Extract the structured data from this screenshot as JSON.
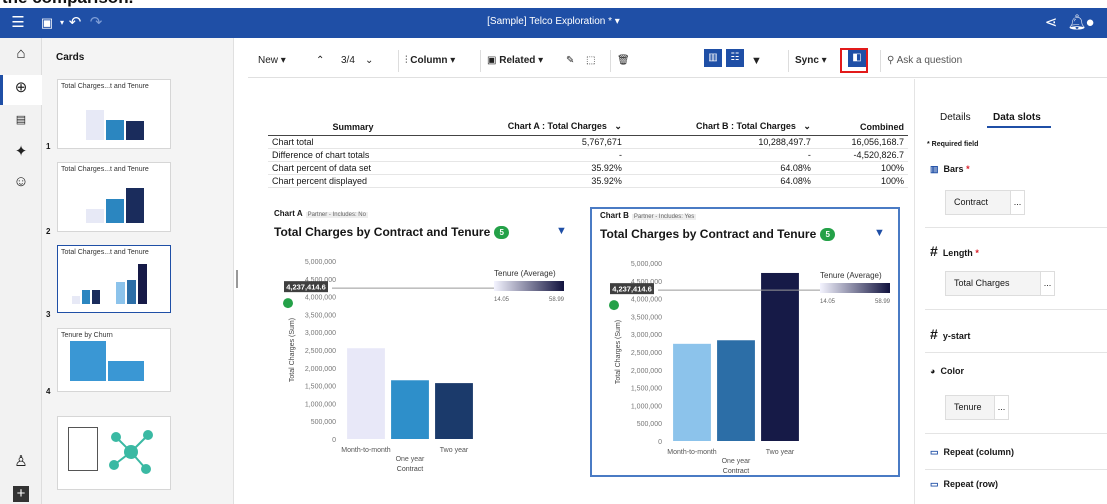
{
  "caption": "the comparison.",
  "topbar": {
    "title": "[Sample] Telco Exploration *",
    "icons": [
      "menu-icon",
      "save-icon",
      "undo-icon",
      "redo-icon",
      "share-icon",
      "bell-icon",
      "user-icon"
    ]
  },
  "cards_panel": {
    "title": "Cards",
    "cards": [
      {
        "title": "Total Charges...t and Tenure",
        "number": "1"
      },
      {
        "title": "Total Charges...t and Tenure",
        "number": "2"
      },
      {
        "title": "Total Charges...t and Tenure",
        "number": "3"
      },
      {
        "title": "Tenure by Churn",
        "number": "4"
      },
      {
        "title": "",
        "number": ""
      }
    ]
  },
  "toolbar": {
    "new_label": "New",
    "page": "3/4",
    "column_label": "Column",
    "related_label": "Related",
    "sync_label": "Sync",
    "ask_placeholder": "Ask a question"
  },
  "summary": {
    "headers": [
      "Summary",
      "Chart A : Total Charges",
      "Chart B : Total Charges",
      "Combined"
    ],
    "rows": [
      [
        "Chart total",
        "5,767,671",
        "10,288,497.7",
        "16,056,168.7"
      ],
      [
        "Difference of chart totals",
        "-",
        "-",
        "-4,520,826.7"
      ],
      [
        "Chart percent of data set",
        "35.92%",
        "64.08%",
        "100%"
      ],
      [
        "Chart percent displayed",
        "35.92%",
        "64.08%",
        "100%"
      ]
    ]
  },
  "chart_a": {
    "label": "Chart A",
    "tag": "Partner - Includes: No",
    "title": "Total Charges by Contract and Tenure",
    "badge": "5"
  },
  "chart_b": {
    "label": "Chart B",
    "tag": "Partner - Includes: Yes",
    "title": "Total Charges by Contract and Tenure",
    "badge": "5"
  },
  "chart_data": [
    {
      "type": "bar",
      "title": "Total Charges by Contract and Tenure",
      "xlabel": "Contract",
      "ylabel": "Total Charges (Sum)",
      "categories": [
        "Month-to-month",
        "One year",
        "Two year"
      ],
      "values": [
        2550000,
        1650000,
        1570000
      ],
      "colors": [
        "#e8e8f8",
        "#2e8fca",
        "#1b3a6b"
      ],
      "ylim": [
        0,
        5000000
      ],
      "yticks": [
        "5,000,000",
        "4,500,000",
        "4,000,000",
        "3,500,000",
        "3,000,000",
        "2,500,000",
        "2,000,000",
        "1,500,000",
        "1,000,000",
        "500,000",
        "0"
      ],
      "reference_line": 4237414.6,
      "reference_label": "4,237,414.6",
      "legend": {
        "title": "Tenure (Average)",
        "min": "14.05",
        "max": "58.99"
      }
    },
    {
      "type": "bar",
      "title": "Total Charges by Contract and Tenure",
      "xlabel": "Contract",
      "ylabel": "Total Charges (Sum)",
      "categories": [
        "Month-to-month",
        "One year",
        "Two year"
      ],
      "values": [
        2730000,
        2830000,
        4720000
      ],
      "colors": [
        "#8cc3eb",
        "#2c6ea7",
        "#161a47"
      ],
      "ylim": [
        0,
        5000000
      ],
      "yticks": [
        "5,000,000",
        "4,500,000",
        "4,000,000",
        "3,500,000",
        "3,000,000",
        "2,500,000",
        "2,000,000",
        "1,500,000",
        "1,000,000",
        "500,000",
        "0"
      ],
      "reference_line": 4237414.6,
      "reference_label": "4,237,414.6",
      "legend": {
        "title": "Tenure (Average)",
        "min": "14.05",
        "max": "58.99"
      }
    }
  ],
  "right_panel": {
    "tab_details": "Details",
    "tab_slots": "Data slots",
    "required": "* Required field",
    "bars_label": "Bars",
    "bars_value": "Contract",
    "length_label": "Length",
    "length_value": "Total Charges",
    "ystart_label": "y-start",
    "color_label": "Color",
    "color_value": "Tenure",
    "repeat_col_label": "Repeat (column)",
    "repeat_row_label": "Repeat (row)",
    "more": "..."
  }
}
